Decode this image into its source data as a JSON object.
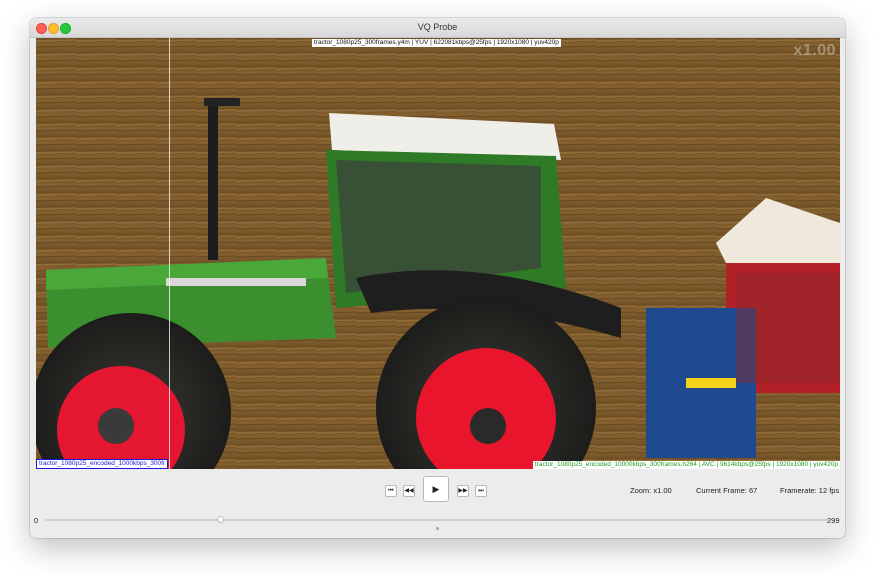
{
  "window": {
    "title": "VQ Probe"
  },
  "video": {
    "top_label": "tractor_1080p25_300frames.y4m | YUV | 622081kbps@25fps | 1920x1080 | yuv420p",
    "bottom_left_label": "tractor_1080p25_encoded_1000kbps_300fr",
    "bottom_right_label": "tractor_1080p25_encoded_10000kbps_300frames.h264 | AVC | 9614kbps@25fps | 1920x1080 | yuv420p",
    "watermark": "x1.00"
  },
  "controls": {
    "skip_start_icon": "⏮",
    "step_back_icon": "◀◀",
    "play_icon": "▶",
    "step_forward_icon": "▶▶",
    "skip_end_icon": "⏭",
    "zoom_label": "Zoom:",
    "zoom_value": "x1.00",
    "current_frame_label": "Current Frame:",
    "current_frame_value": "67",
    "framerate_label": "Framerate:",
    "framerate_value": "12",
    "framerate_unit": "fps"
  },
  "slider": {
    "min": "0",
    "max": "299",
    "position": 67
  }
}
